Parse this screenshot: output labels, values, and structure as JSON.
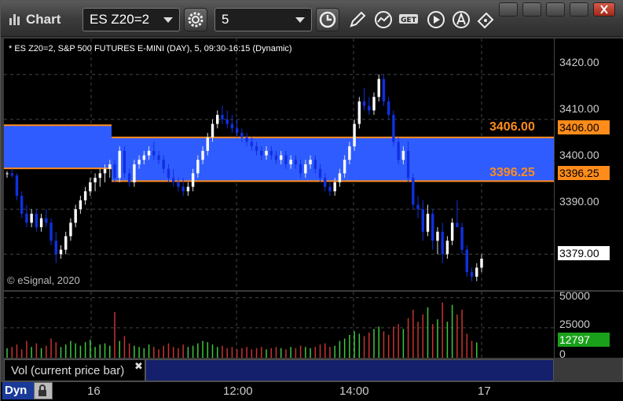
{
  "window": {
    "title": "Chart",
    "symbol": "ES Z20=2",
    "interval": "5"
  },
  "chart_header": "* ES Z20=2, S&P 500 FUTURES E-MINI (DAY), 5, 09:30-16:15 (Dynamic)",
  "copyright": "© eSignal, 2020",
  "price_axis": {
    "ticks": [
      "3420.00",
      "3410.00",
      "3400.00",
      "3390.00"
    ],
    "current_price": "3379.00",
    "level_upper": "3406.00",
    "level_lower": "3396.25"
  },
  "level_labels": {
    "upper": "3406.00",
    "lower": "3396.25"
  },
  "volume_axis": {
    "ticks": [
      "50000",
      "25000",
      "0"
    ],
    "current_volume": "12797"
  },
  "volume_study_label": "Vol (current price bar)",
  "time_axis": {
    "labels": [
      "16",
      "12:00",
      "14:00",
      "17"
    ]
  },
  "bottom_mode": "Dyn",
  "colors": {
    "zone_fill": "#2f5cff",
    "level_line": "#ff8c1a",
    "up_candle": "#ffffff",
    "down_candle": "#1030e0",
    "vol_up": "#3cc83c",
    "vol_down": "#c83232",
    "current_volume_bg": "#1aa01a"
  },
  "chart_data": {
    "type": "candlestick",
    "price_range": [
      3372,
      3428
    ],
    "volume_range": [
      0,
      55000
    ],
    "zones": [
      {
        "from_bar": 0,
        "to_bar": 22,
        "high": 3408.7,
        "low": 3399.1
      },
      {
        "from_bar": 22,
        "to_bar": 121,
        "high": 3406.0,
        "low": 3396.25
      }
    ],
    "candles": [
      [
        3398,
        3398.5,
        3397,
        3398
      ],
      [
        3398,
        3399,
        3397,
        3397.5
      ],
      [
        3397.5,
        3398,
        3392,
        3393
      ],
      [
        3393,
        3394,
        3388,
        3389
      ],
      [
        3389,
        3391,
        3386,
        3387
      ],
      [
        3387,
        3390,
        3386,
        3389
      ],
      [
        3389,
        3390,
        3385,
        3386
      ],
      [
        3386,
        3389,
        3385,
        3388
      ],
      [
        3388,
        3390,
        3386,
        3387
      ],
      [
        3387,
        3388,
        3382,
        3383
      ],
      [
        3383,
        3385,
        3378,
        3380
      ],
      [
        3380,
        3382,
        3379,
        3381
      ],
      [
        3381,
        3385,
        3380,
        3384
      ],
      [
        3384,
        3388,
        3383,
        3387
      ],
      [
        3387,
        3391,
        3386,
        3390
      ],
      [
        3390,
        3393,
        3389,
        3392
      ],
      [
        3392,
        3395,
        3391,
        3394
      ],
      [
        3394,
        3397,
        3393,
        3396
      ],
      [
        3396,
        3398,
        3394,
        3397
      ],
      [
        3397,
        3399,
        3395,
        3398
      ],
      [
        3398,
        3400,
        3396,
        3399
      ],
      [
        3399,
        3401,
        3397,
        3400
      ],
      [
        3400,
        3401,
        3396,
        3397
      ],
      [
        3397,
        3404,
        3396,
        3403
      ],
      [
        3403,
        3404,
        3397,
        3398
      ],
      [
        3398,
        3399,
        3395,
        3396
      ],
      [
        3396,
        3401,
        3395,
        3400
      ],
      [
        3400,
        3402,
        3399,
        3401
      ],
      [
        3401,
        3403,
        3400,
        3402
      ],
      [
        3402,
        3404,
        3401,
        3403
      ],
      [
        3403,
        3405,
        3401,
        3402
      ],
      [
        3402,
        3403,
        3400,
        3401
      ],
      [
        3401,
        3402,
        3398,
        3399
      ],
      [
        3399,
        3400,
        3396,
        3397
      ],
      [
        3397,
        3399,
        3395,
        3396
      ],
      [
        3396,
        3397,
        3394,
        3395
      ],
      [
        3395,
        3397,
        3393,
        3394
      ],
      [
        3394,
        3396,
        3393,
        3395
      ],
      [
        3395,
        3399,
        3394,
        3398
      ],
      [
        3398,
        3402,
        3397,
        3401
      ],
      [
        3401,
        3404,
        3400,
        3403
      ],
      [
        3403,
        3407,
        3402,
        3406
      ],
      [
        3406,
        3410,
        3405,
        3409
      ],
      [
        3409,
        3412,
        3408,
        3411
      ],
      [
        3411,
        3413,
        3409,
        3410
      ],
      [
        3410,
        3412,
        3408,
        3409
      ],
      [
        3409,
        3411,
        3407,
        3408
      ],
      [
        3408,
        3410,
        3406,
        3407
      ],
      [
        3407,
        3408,
        3405,
        3406
      ],
      [
        3406,
        3407,
        3404,
        3405
      ],
      [
        3405,
        3406,
        3403,
        3404
      ],
      [
        3404,
        3405,
        3402,
        3403
      ],
      [
        3403,
        3404,
        3401,
        3402
      ],
      [
        3402,
        3404,
        3401,
        3403
      ],
      [
        3403,
        3404,
        3401,
        3402
      ],
      [
        3402,
        3403,
        3400,
        3401
      ],
      [
        3401,
        3403,
        3400,
        3402
      ],
      [
        3402,
        3403,
        3399,
        3400
      ],
      [
        3400,
        3402,
        3399,
        3401
      ],
      [
        3401,
        3402,
        3399,
        3400
      ],
      [
        3400,
        3401,
        3397,
        3398
      ],
      [
        3398,
        3401,
        3397,
        3400
      ],
      [
        3400,
        3402,
        3399,
        3401
      ],
      [
        3401,
        3402,
        3398,
        3399
      ],
      [
        3399,
        3400,
        3396,
        3397
      ],
      [
        3397,
        3398,
        3394,
        3395
      ],
      [
        3395,
        3396,
        3393,
        3394
      ],
      [
        3394,
        3397,
        3393,
        3396
      ],
      [
        3396,
        3399,
        3395,
        3398
      ],
      [
        3398,
        3402,
        3397,
        3401
      ],
      [
        3401,
        3405,
        3400,
        3404
      ],
      [
        3404,
        3410,
        3403,
        3409
      ],
      [
        3409,
        3415,
        3408,
        3414
      ],
      [
        3414,
        3417,
        3412,
        3413
      ],
      [
        3413,
        3415,
        3411,
        3412
      ],
      [
        3412,
        3416,
        3411,
        3415
      ],
      [
        3415,
        3420,
        3414,
        3419
      ],
      [
        3419,
        3420,
        3413,
        3414
      ],
      [
        3414,
        3415,
        3410,
        3411
      ],
      [
        3411,
        3412,
        3404,
        3405
      ],
      [
        3405,
        3406,
        3400,
        3401
      ],
      [
        3401,
        3404,
        3400,
        3403
      ],
      [
        3403,
        3405,
        3396,
        3397
      ],
      [
        3397,
        3398,
        3390,
        3391
      ],
      [
        3391,
        3393,
        3388,
        3390
      ],
      [
        3390,
        3392,
        3383,
        3385
      ],
      [
        3385,
        3391,
        3384,
        3389
      ],
      [
        3389,
        3390,
        3381,
        3383
      ],
      [
        3383,
        3386,
        3380,
        3385
      ],
      [
        3385,
        3387,
        3378,
        3380
      ],
      [
        3380,
        3384,
        3379,
        3383
      ],
      [
        3383,
        3388,
        3382,
        3387
      ],
      [
        3387,
        3392,
        3386,
        3386
      ],
      [
        3386,
        3387,
        3380,
        3381
      ],
      [
        3381,
        3382,
        3375,
        3376
      ],
      [
        3376,
        3377,
        3374,
        3375
      ],
      [
        3375,
        3378,
        3374,
        3377
      ],
      [
        3377,
        3380,
        3376,
        3379
      ]
    ],
    "volumes": [
      8000,
      9000,
      11000,
      7000,
      14000,
      9000,
      12000,
      8000,
      10000,
      16000,
      13000,
      9000,
      11000,
      14000,
      12000,
      10000,
      13000,
      15000,
      9000,
      11000,
      12000,
      10000,
      38000,
      14000,
      18000,
      12000,
      10000,
      9000,
      8000,
      11000,
      9000,
      7000,
      10000,
      12000,
      9000,
      8000,
      11000,
      9000,
      10000,
      12000,
      14000,
      13000,
      11000,
      9000,
      10000,
      8000,
      9000,
      7000,
      8000,
      9000,
      7000,
      8000,
      9000,
      7000,
      8000,
      9000,
      8000,
      7000,
      9000,
      8000,
      10000,
      9000,
      8000,
      9000,
      11000,
      12000,
      9000,
      10000,
      14000,
      16000,
      19000,
      22000,
      20000,
      18000,
      21000,
      24000,
      26000,
      22000,
      19000,
      26000,
      28000,
      24000,
      33000,
      40000,
      30000,
      36000,
      42000,
      28000,
      32000,
      46000,
      30000,
      44000,
      36000,
      40000,
      20000,
      14000,
      12797
    ]
  }
}
